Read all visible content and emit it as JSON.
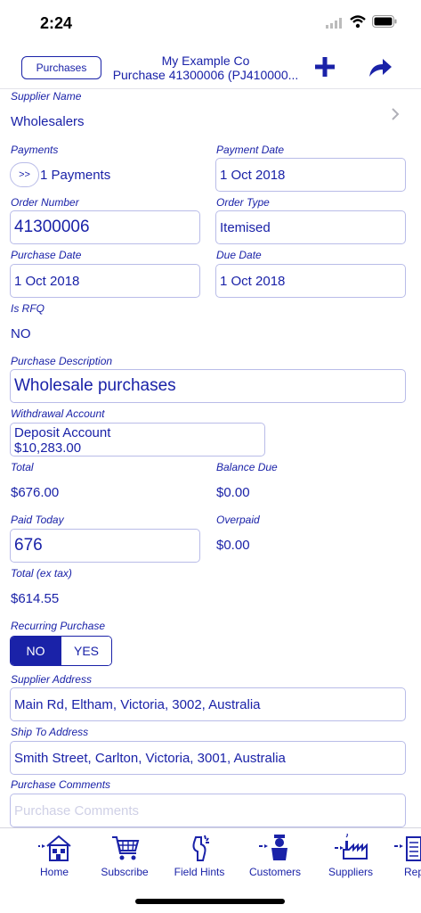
{
  "status": {
    "time": "2:24"
  },
  "nav": {
    "back_label": "Purchases",
    "title_line1": "My Example Co",
    "title_line2": "Purchase 41300006 (PJ410000..."
  },
  "form": {
    "supplier_name": {
      "label": "Supplier Name",
      "value": "Wholesalers"
    },
    "payments": {
      "label": "Payments",
      "toggle_label": ">>",
      "value": "1 Payments"
    },
    "payment_date": {
      "label": "Payment Date",
      "value": "1 Oct 2018"
    },
    "order_number": {
      "label": "Order Number",
      "value": "41300006"
    },
    "order_type": {
      "label": "Order Type",
      "value": "Itemised"
    },
    "purchase_date": {
      "label": "Purchase Date",
      "value": "1 Oct 2018"
    },
    "due_date": {
      "label": "Due Date",
      "value": "1 Oct 2018"
    },
    "is_rfq": {
      "label": "Is RFQ",
      "value": "NO"
    },
    "purchase_description": {
      "label": "Purchase Description",
      "value": "Wholesale purchases"
    },
    "withdrawal_account": {
      "label": "Withdrawal Account",
      "name": "Deposit Account",
      "balance": "$10,283.00"
    },
    "total": {
      "label": "Total",
      "value": "$676.00"
    },
    "balance_due": {
      "label": "Balance Due",
      "value": "$0.00"
    },
    "paid_today": {
      "label": "Paid Today",
      "value": "676"
    },
    "overpaid": {
      "label": "Overpaid",
      "value": "$0.00"
    },
    "total_ex_tax": {
      "label": "Total (ex tax)",
      "value": "$614.55"
    },
    "recurring_purchase": {
      "label": "Recurring Purchase",
      "options": [
        "NO",
        "YES"
      ],
      "selected": "NO"
    },
    "supplier_address": {
      "label": "Supplier Address",
      "value": "Main Rd, Eltham, Victoria, 3002, Australia"
    },
    "ship_to_address": {
      "label": "Ship To Address",
      "value": "Smith Street, Carlton, Victoria, 3001, Australia"
    },
    "purchase_comments": {
      "label": "Purchase Comments",
      "placeholder": "Purchase Comments"
    }
  },
  "tabs": [
    {
      "label": "Home",
      "icon": "home-icon"
    },
    {
      "label": "Subscribe",
      "icon": "cart-icon"
    },
    {
      "label": "Field Hints",
      "icon": "hint-icon"
    },
    {
      "label": "Customers",
      "icon": "customers-icon"
    },
    {
      "label": "Suppliers",
      "icon": "suppliers-icon"
    },
    {
      "label": "Rep",
      "icon": "reports-icon"
    }
  ],
  "colors": {
    "accent": "#1a22a8",
    "border": "#b9bce8"
  }
}
